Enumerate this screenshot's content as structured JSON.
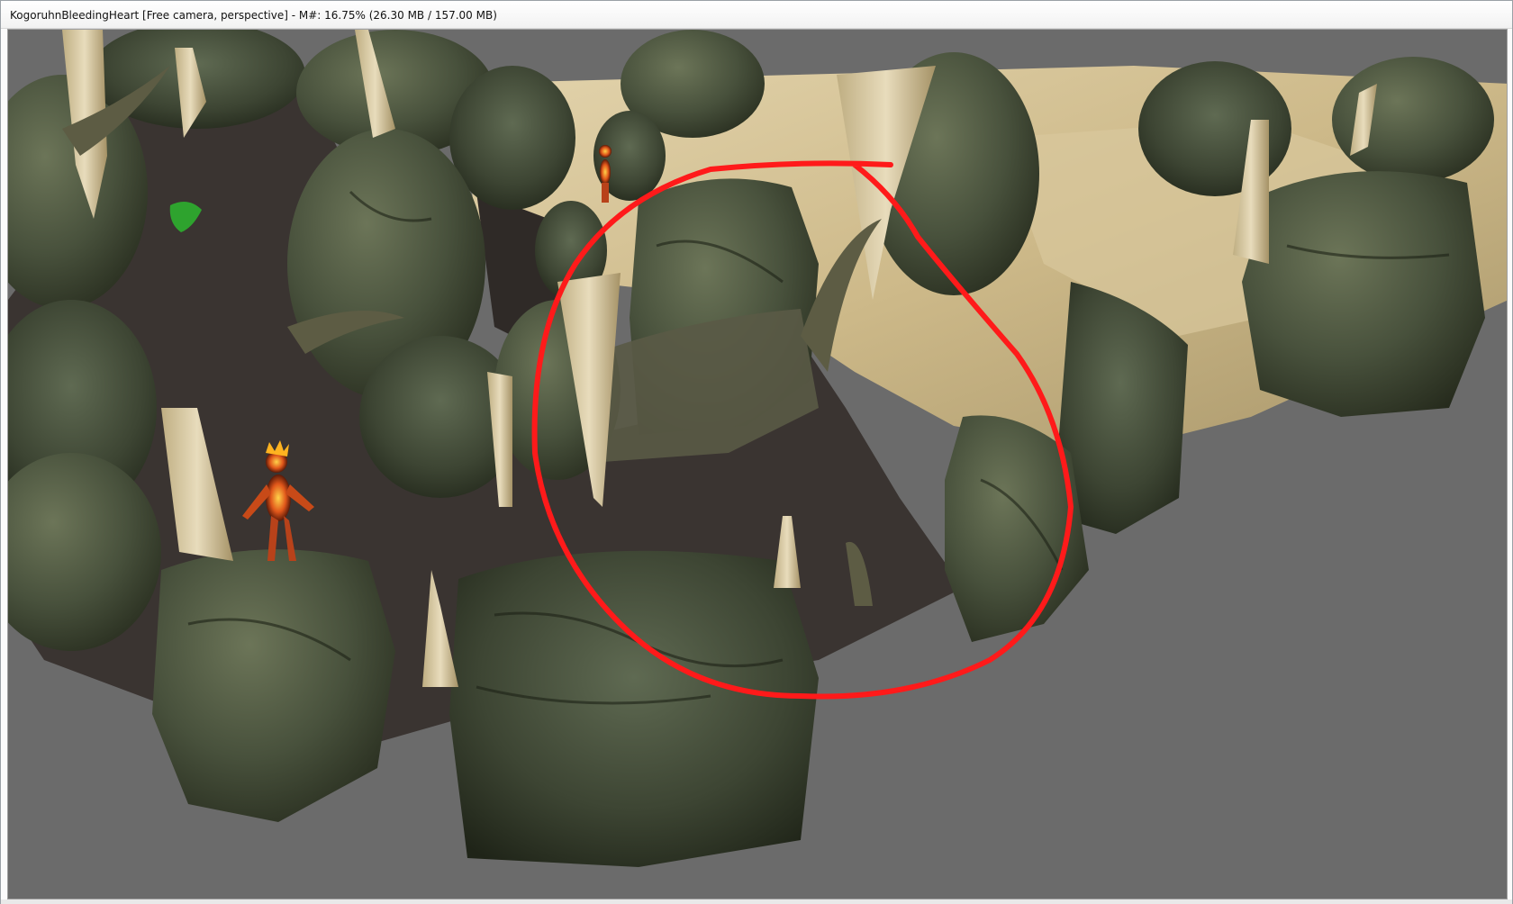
{
  "window": {
    "title": "KogoruhnBleedingHeart [Free camera, perspective] - M#: 16.75% (26.30 MB / 157.00 MB)"
  },
  "viewport": {
    "background_color": "#6b6b6b",
    "annotation_color": "#ff1a1a",
    "objects": [
      "dark-rock",
      "pale-rock",
      "spire",
      "fire-creature",
      "green-plant",
      "red-circle-annotation"
    ]
  }
}
